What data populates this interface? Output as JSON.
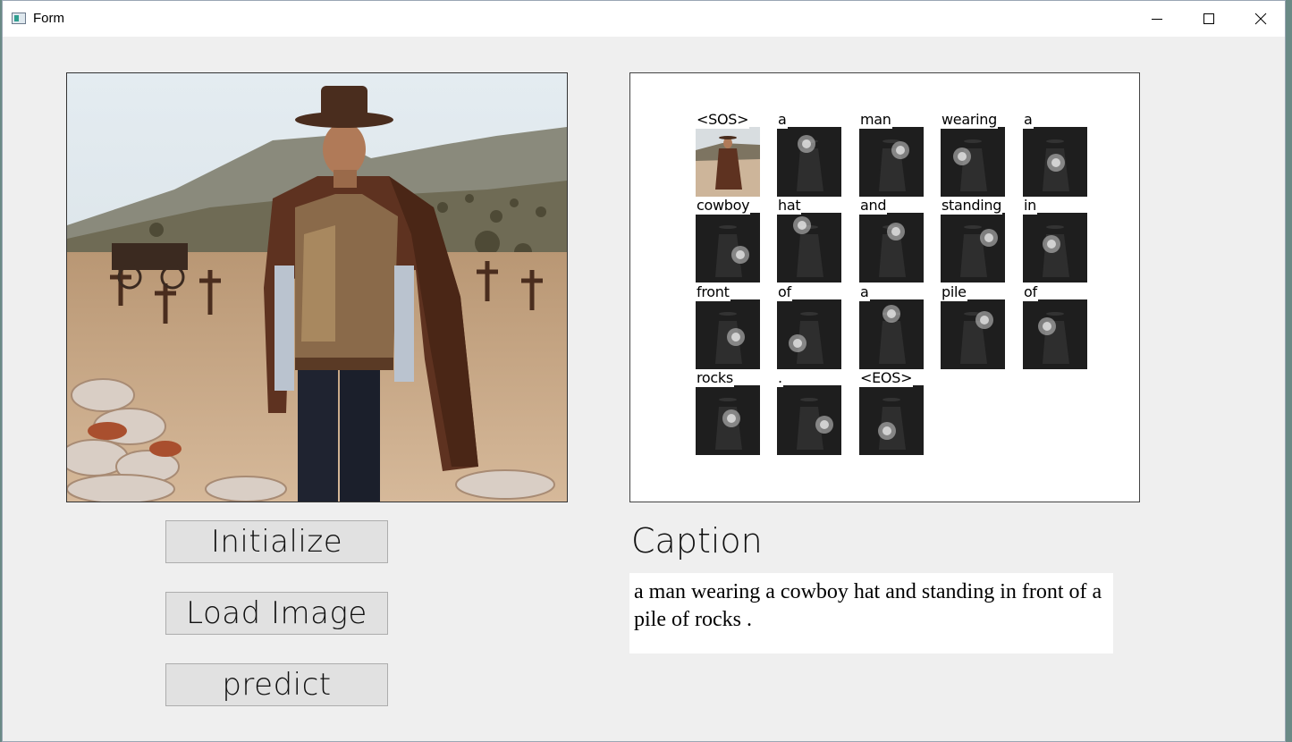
{
  "window": {
    "title": "Form",
    "controls": {
      "minimize": "minimize-icon",
      "maximize": "maximize-icon",
      "close": "close-icon"
    }
  },
  "image_panel": {
    "description_icon": "photo",
    "colors": {
      "sky": "#dfe6ea",
      "ground": "#c9a583",
      "poncho": "#5e3220"
    }
  },
  "attention": {
    "tokens": [
      "<SOS>",
      "a",
      "man",
      "wearing",
      "a",
      "cowboy",
      "hat",
      "and",
      "standing",
      "in",
      "front",
      "of",
      "a",
      "pile",
      "of",
      "rocks",
      ".",
      "<EOS>"
    ],
    "columns": 5
  },
  "buttons": {
    "initialize": "Initialize",
    "load_image": "Load Image",
    "predict": "predict"
  },
  "caption": {
    "heading": "Caption",
    "text": "a man wearing a cowboy hat and standing in front of a pile of rocks ."
  }
}
